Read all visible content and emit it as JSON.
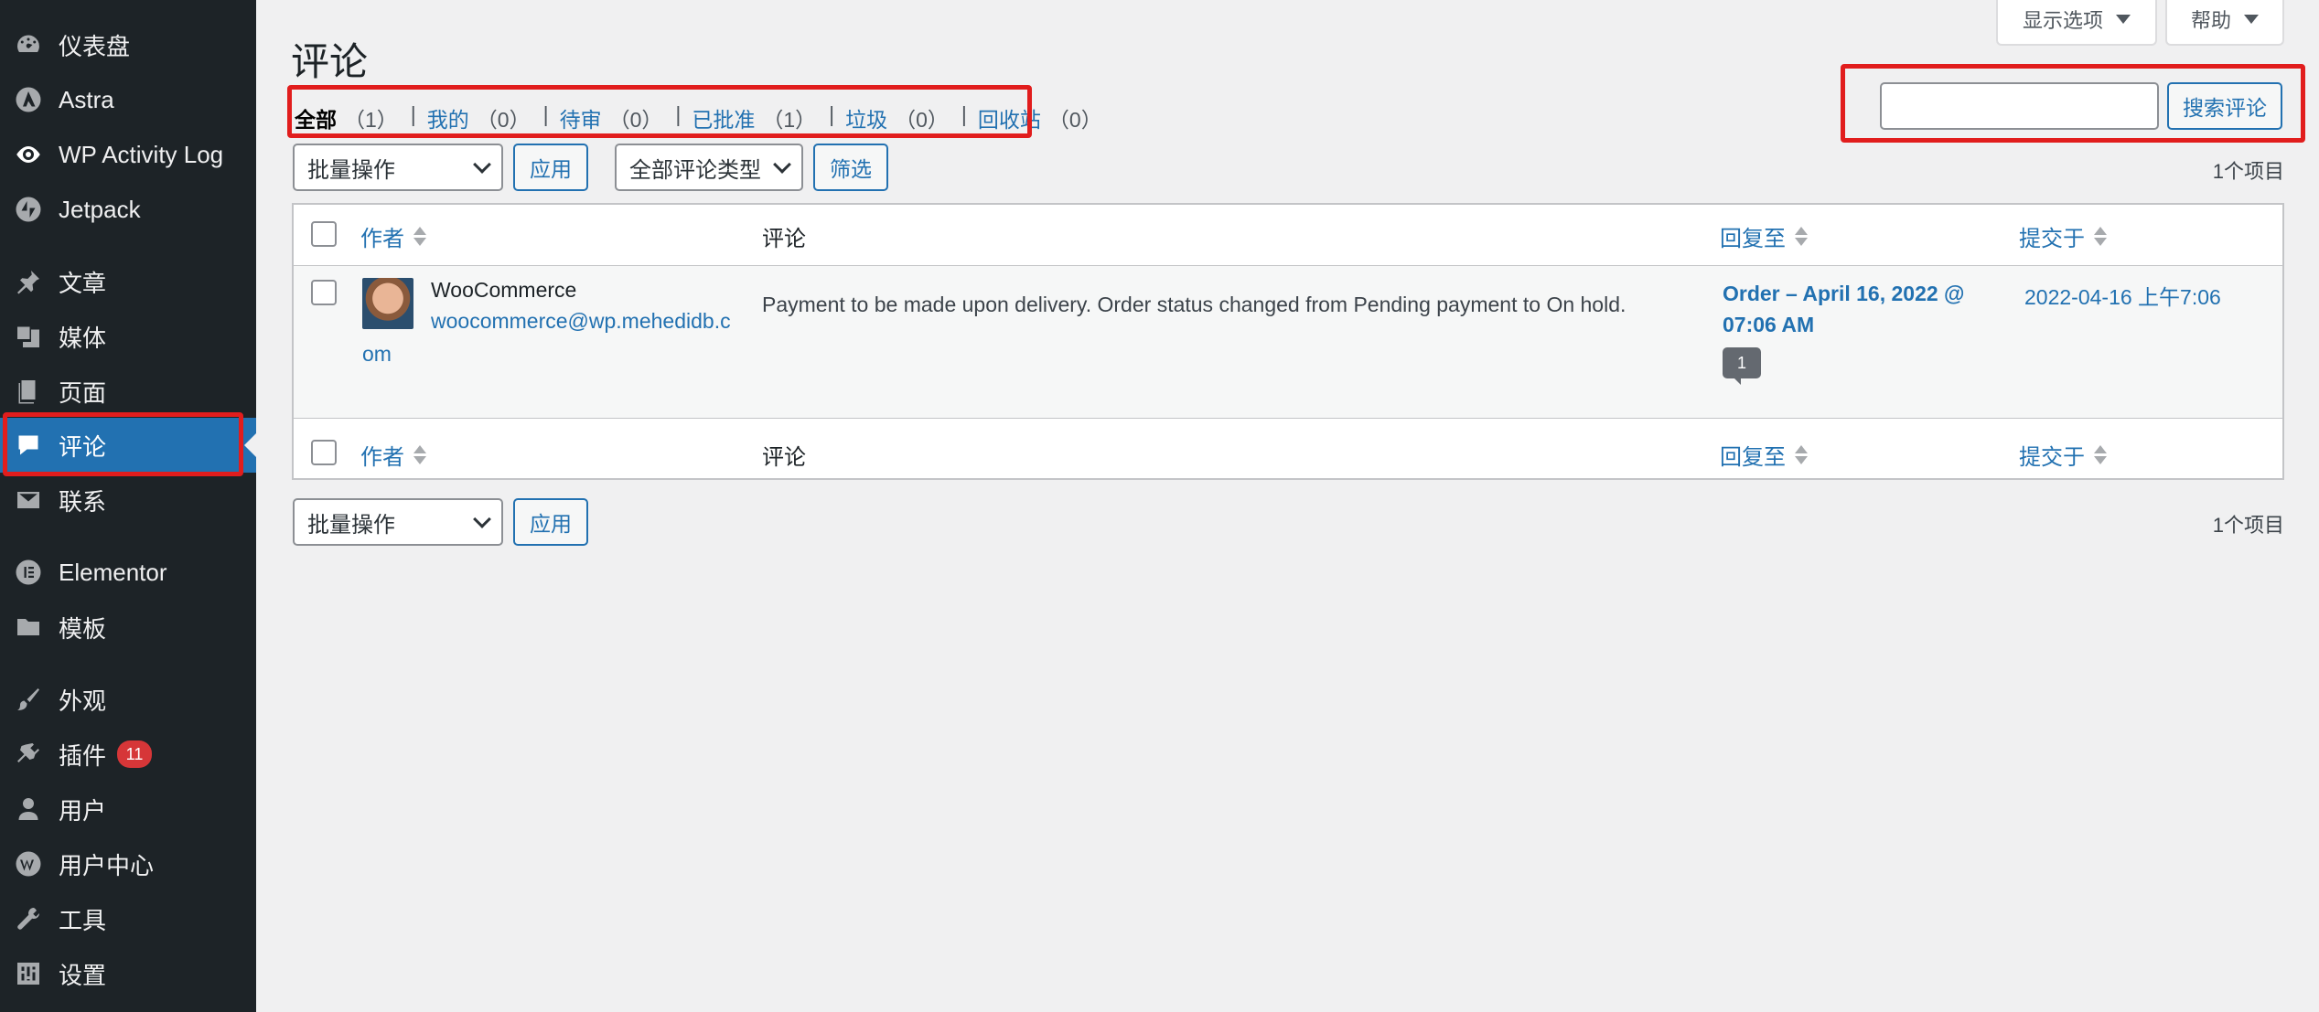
{
  "sidebar": {
    "items": [
      {
        "label": "仪表盘",
        "icon": "dashboard-icon"
      },
      {
        "label": "Astra",
        "icon": "astra-icon"
      },
      {
        "label": "WP Activity Log",
        "icon": "eye-icon"
      },
      {
        "label": "Jetpack",
        "icon": "jetpack-icon"
      },
      {
        "label": "文章",
        "icon": "pin-icon"
      },
      {
        "label": "媒体",
        "icon": "media-icon"
      },
      {
        "label": "页面",
        "icon": "page-icon"
      },
      {
        "label": "评论",
        "icon": "comment-icon"
      },
      {
        "label": "联系",
        "icon": "mail-icon"
      },
      {
        "label": "Elementor",
        "icon": "elementor-icon"
      },
      {
        "label": "模板",
        "icon": "folder-icon"
      },
      {
        "label": "外观",
        "icon": "brush-icon"
      },
      {
        "label": "插件",
        "icon": "plugin-icon",
        "badge": "11"
      },
      {
        "label": "用户",
        "icon": "user-icon"
      },
      {
        "label": "用户中心",
        "icon": "wp-icon"
      },
      {
        "label": "工具",
        "icon": "wrench-icon"
      },
      {
        "label": "设置",
        "icon": "settings-icon"
      }
    ],
    "active_index": 7,
    "accent_color": "#2271b1"
  },
  "top_buttons": {
    "screen_options": "显示选项",
    "help": "帮助"
  },
  "page_title": "评论",
  "filters": [
    {
      "label": "全部",
      "count": "（1）",
      "current": true
    },
    {
      "label": "我的",
      "count": "（0）"
    },
    {
      "label": "待审",
      "count": "（0）"
    },
    {
      "label": "已批准",
      "count": "（1）"
    },
    {
      "label": "垃圾",
      "count": "（0）"
    },
    {
      "label": "回收站",
      "count": "（0）"
    }
  ],
  "search": {
    "value": "",
    "button": "搜索评论"
  },
  "bulk_actions": {
    "selected": "批量操作",
    "apply": "应用",
    "comment_type": "全部评论类型",
    "filter": "筛选"
  },
  "items_count": "1个项目",
  "table": {
    "headers": {
      "author": "作者",
      "comment": "评论",
      "reply_to": "回复至",
      "submitted": "提交于"
    },
    "rows": [
      {
        "author_name": "WooCommerce",
        "author_email_line1": "woocommerce@wp.mehedidb.c",
        "author_email_line2": "om",
        "comment": "Payment to be made upon delivery. Order status changed from Pending payment to On hold.",
        "reply_to_line1": "Order – April 16, 2022 @",
        "reply_to_line2": "07:06 AM",
        "comment_count": "1",
        "submitted": "2022-04-16 上午7:06"
      }
    ]
  },
  "highlight_color": "#e11d1d"
}
